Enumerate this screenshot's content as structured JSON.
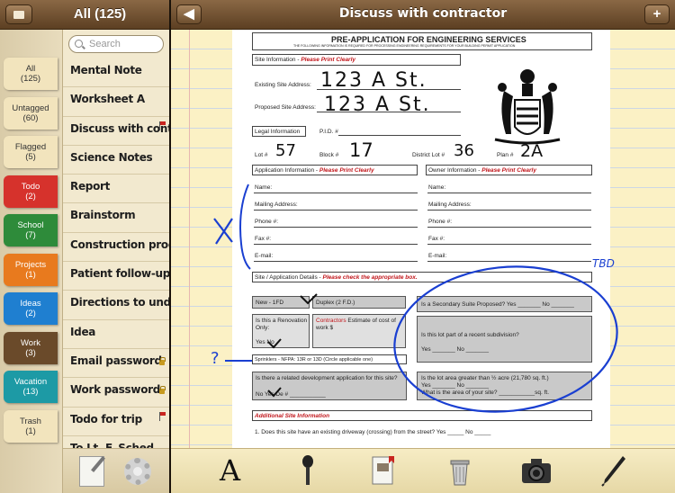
{
  "left_header": {
    "title": "All (125)"
  },
  "tabs": [
    {
      "label": "All",
      "count": "(125)",
      "color": "#f2e4bd"
    },
    {
      "label": "Untagged",
      "count": "(60)",
      "color": "#f2e4bd"
    },
    {
      "label": "Flagged",
      "count": "(5)",
      "color": "#f2e4bd"
    },
    {
      "label": "Todo",
      "count": "(2)",
      "color": "#d6322c"
    },
    {
      "label": "School",
      "count": "(7)",
      "color": "#2e8b3a"
    },
    {
      "label": "Projects",
      "count": "(1)",
      "color": "#e87a1e"
    },
    {
      "label": "Ideas",
      "count": "(2)",
      "color": "#1f7fd0"
    },
    {
      "label": "Work",
      "count": "(3)",
      "color": "#6a4a2a"
    },
    {
      "label": "Vacation",
      "count": "(13)",
      "color": "#1d9aa5"
    },
    {
      "label": "Trash",
      "count": "(1)",
      "color": "#f2e4bd"
    }
  ],
  "search": {
    "placeholder": "Search"
  },
  "notes": [
    {
      "title": "Mental Note"
    },
    {
      "title": "Worksheet A"
    },
    {
      "title": "Discuss with contr...",
      "flag": true
    },
    {
      "title": "Science Notes"
    },
    {
      "title": "Report"
    },
    {
      "title": "Brainstorm"
    },
    {
      "title": "Construction progr..."
    },
    {
      "title": "Patient follow-up"
    },
    {
      "title": "Directions to unde..."
    },
    {
      "title": "Idea"
    },
    {
      "title": "Email password",
      "lock": true
    },
    {
      "title": "Work password",
      "lock": true
    },
    {
      "title": "Todo for trip",
      "flag": true
    },
    {
      "title": "To Lt. F. Sched..."
    }
  ],
  "right_header": {
    "title": "Discuss with contractor",
    "back": "◀",
    "add": "+"
  },
  "document": {
    "heading": "PRE-APPLICATION FOR ENGINEERING SERVICES",
    "subheading": "THE FOLLOWING INFORMATION IS REQUIRED FOR PROCESSING ENGINEERING REQUIREMENTS FOR YOUR BUILDING PERMIT APPLICATION",
    "site_info": "Site Information - ",
    "print_clearly": "Please Print Clearly",
    "existing_address_label": "Existing Site Address:",
    "existing_address_value": "123 A St.",
    "proposed_address_label": "Proposed Site Address:",
    "proposed_address_value": "123 A St.",
    "legal_info": "Legal Information",
    "pid": "P.I.D. #",
    "lot_label": "Lot #",
    "lot_value": "57",
    "block_label": "Block #",
    "block_value": "17",
    "district_label": "District Lot #",
    "district_value": "36",
    "plan_label": "Plan #",
    "plan_value": "2A",
    "applicant_info": "Application Information - ",
    "owner_info": "Owner Information - ",
    "fields": [
      "Name:",
      "Mailing Address:",
      "Phone #:",
      "Fax #:",
      "E-mail:"
    ],
    "site_details": "Site / Application Details - ",
    "check_box": "Please check the appropriate box.",
    "new_1fd": "New - 1FD",
    "duplex": "Duplex (2 F.D.)",
    "secondary_suite": "Is a Secondary Suite Proposed? Yes _______ No _______",
    "renovation": "Is this a Renovation Only:",
    "yes_no": "Yes  No",
    "contractors": "Contractors",
    "estimate": " Estimate of cost of work $",
    "subdivision": "Is this lot part of a recent subdivision?",
    "subdivision_yn": "Yes _______  No _______",
    "sprinklers": "Sprinklers - NFPA: 13R or 13D (Circle applicable one)",
    "related_dev": "Is there a related development application for this site?",
    "related_yn": "No     Yes    De # ___________",
    "lot_area": "Is the lot area greater than ½ acre (21,780 sq. ft.)",
    "lot_area_yn": "Yes _______  No _______",
    "site_area": "What is the area of your site? ___________sq. ft.",
    "additional": "Additional Site Information",
    "q1": "1. Does this site have an existing driveway (crossing) from the street?  Yes _____  No _____"
  },
  "annotations": {
    "x_mark": "X",
    "tbd": "TBD",
    "question": "?"
  },
  "toolbar": [
    "text-tool-icon",
    "microphone-icon",
    "notebook-icon",
    "trash-icon",
    "camera-icon",
    "pen-icon"
  ],
  "colors": {
    "ink_blue": "#1a3fd1",
    "header_brown": "#6d4e2e",
    "paper": "#fbf1c5"
  }
}
